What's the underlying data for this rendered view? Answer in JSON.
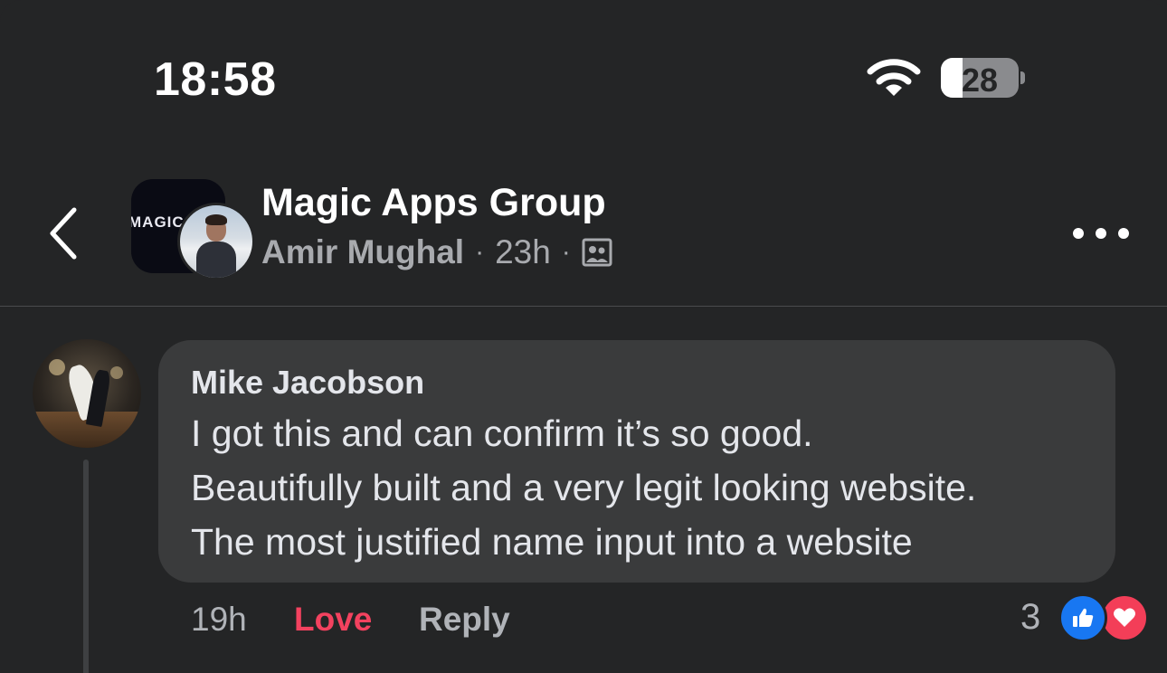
{
  "status_bar": {
    "time": "18:58",
    "battery_level": "28",
    "battery_percent": 28
  },
  "header": {
    "group_name": "Magic Apps Group",
    "group_logo_text": "MAGIC",
    "author": "Amir Mughal",
    "separator": "·",
    "age": "23h",
    "icons": {
      "back": "chevron-left-icon",
      "more": "more-horizontal-icon",
      "privacy": "members-icon"
    }
  },
  "comment": {
    "author": "Mike Jacobson",
    "lines": [
      "I got this and can confirm it’s so good.",
      "Beautifully built and a very legit looking website.",
      "The most justified name input into a website"
    ],
    "actions": {
      "time": "19h",
      "love_label": "Love",
      "reply_label": "Reply"
    },
    "reactions": {
      "count": "3",
      "types": [
        "like",
        "love"
      ]
    }
  },
  "colors": {
    "background": "#242526",
    "bubble": "#3a3b3c",
    "love": "#f3425f",
    "like": "#1877f2",
    "muted": "#b0b3b8"
  }
}
